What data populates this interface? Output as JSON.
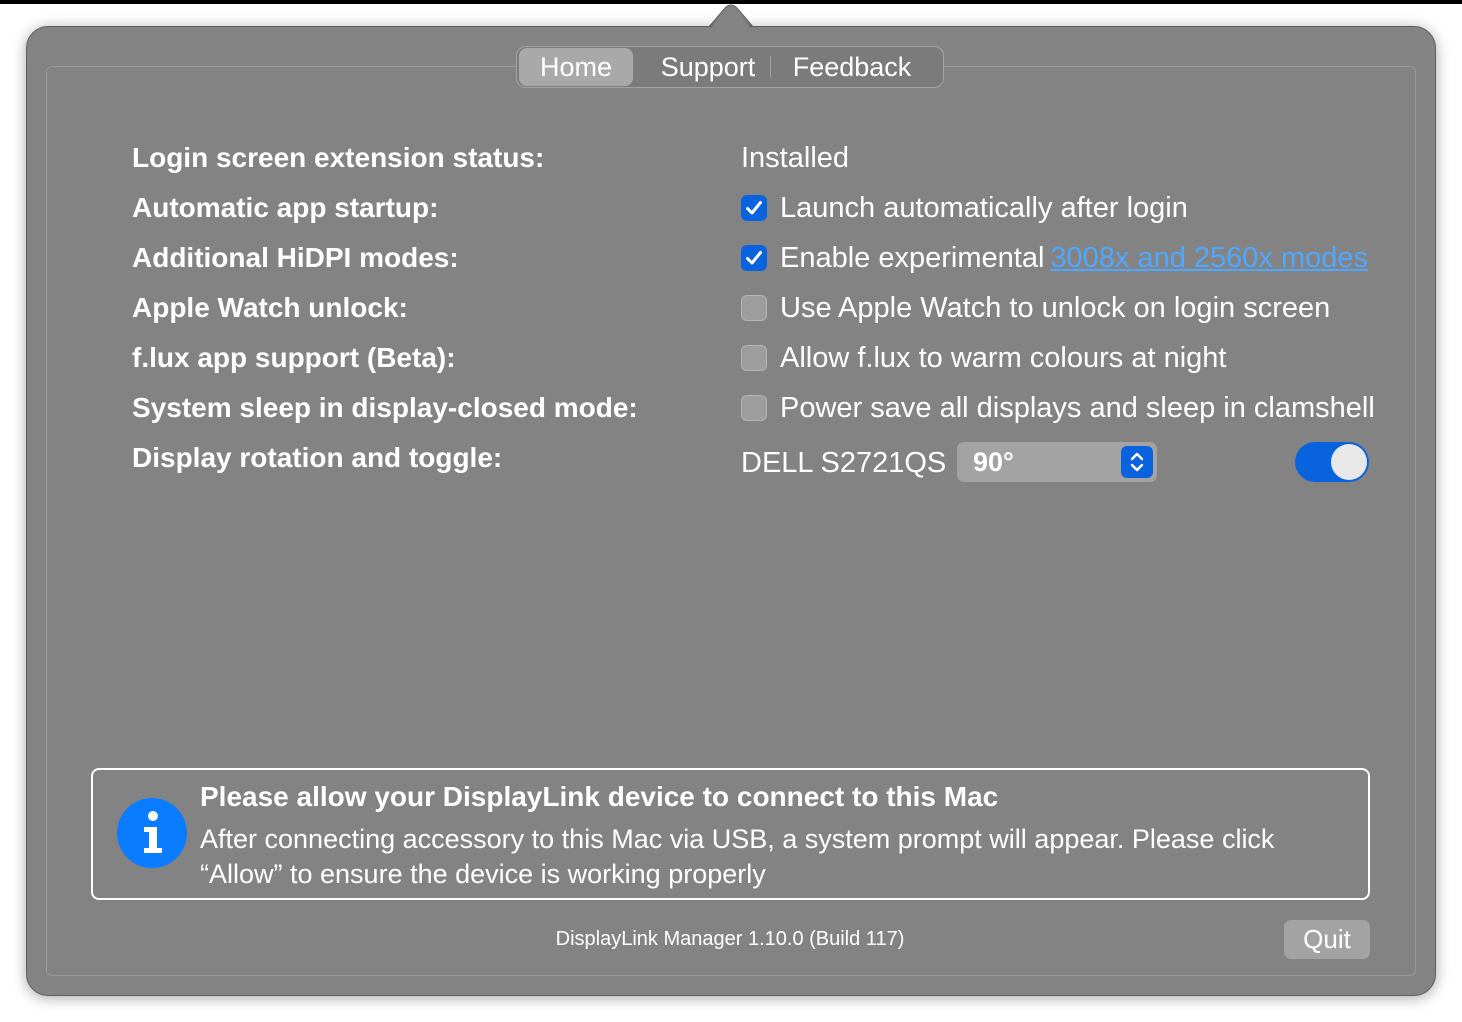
{
  "tabs": [
    {
      "label": "Home",
      "active": true
    },
    {
      "label": "Support",
      "active": false
    },
    {
      "label": "Feedback",
      "active": false
    }
  ],
  "settings": {
    "login_ext": {
      "label": "Login screen extension status:",
      "value": "Installed"
    },
    "startup": {
      "label": "Automatic app startup:",
      "checked": true,
      "text": "Launch automatically after login"
    },
    "hidpi": {
      "label": "Additional HiDPI modes:",
      "checked": true,
      "text": "Enable experimental",
      "link": "3008x and 2560x modes"
    },
    "watch": {
      "label": "Apple Watch unlock:",
      "checked": false,
      "text": "Use Apple Watch to unlock on login screen"
    },
    "flux": {
      "label": "f.lux app support (Beta):",
      "checked": false,
      "text": "Allow f.lux to warm colours at night"
    },
    "sleep": {
      "label": "System sleep in display-closed mode:",
      "checked": false,
      "text": "Power save all displays and sleep in clamshell"
    },
    "rotation": {
      "label": "Display rotation and toggle:",
      "display": "DELL S2721QS",
      "rotation_value": "90°",
      "enabled": true
    }
  },
  "notice": {
    "title": "Please allow your DisplayLink device to connect to this Mac",
    "body": "After connecting accessory to this Mac via USB, a system prompt will appear. Please click “Allow” to ensure the device is working properly"
  },
  "footer": {
    "version": "DisplayLink Manager 1.10.0 (Build 117)",
    "quit_label": "Quit"
  },
  "colors": {
    "accent": "#0a63de",
    "link": "#4fa8ff",
    "panel": "#838383"
  }
}
